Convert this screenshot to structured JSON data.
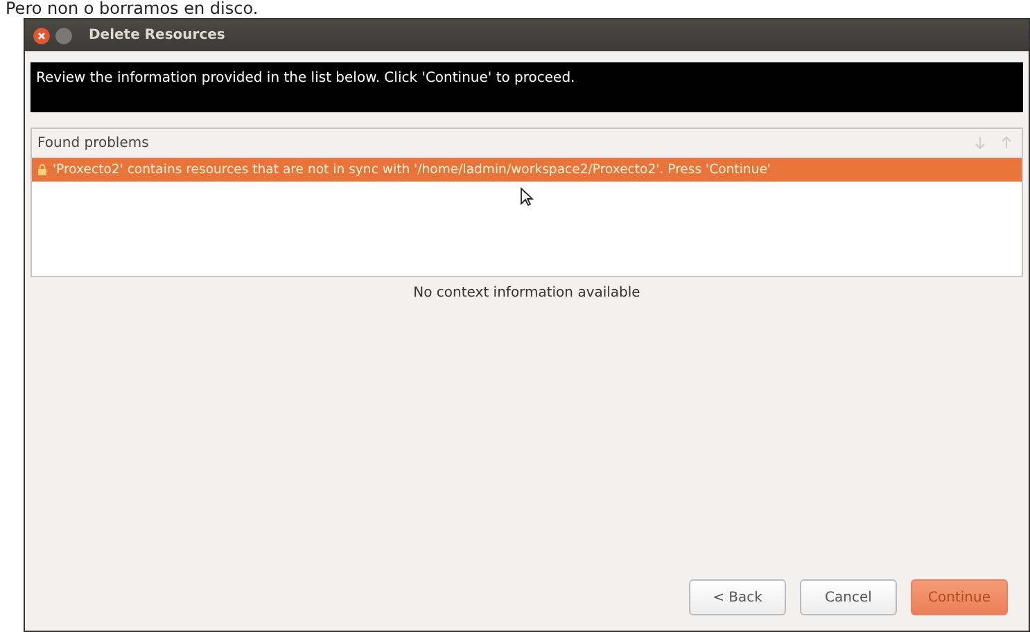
{
  "caption": "Pero non o borramos en disco.",
  "window": {
    "title": "Delete Resources"
  },
  "message": "Review the information provided in the list below. Click 'Continue' to proceed.",
  "problems": {
    "header": "Found problems",
    "items": [
      {
        "text": "'Proxecto2' contains resources that are not in sync with '/home/ladmin/workspace2/Proxecto2'. Press 'Continue'",
        "selected": true
      }
    ]
  },
  "context_info": "No context information available",
  "buttons": [
    {
      "label": "< Back",
      "default": false
    },
    {
      "label": "Cancel",
      "default": false
    },
    {
      "label": "Continue",
      "default": true
    }
  ]
}
